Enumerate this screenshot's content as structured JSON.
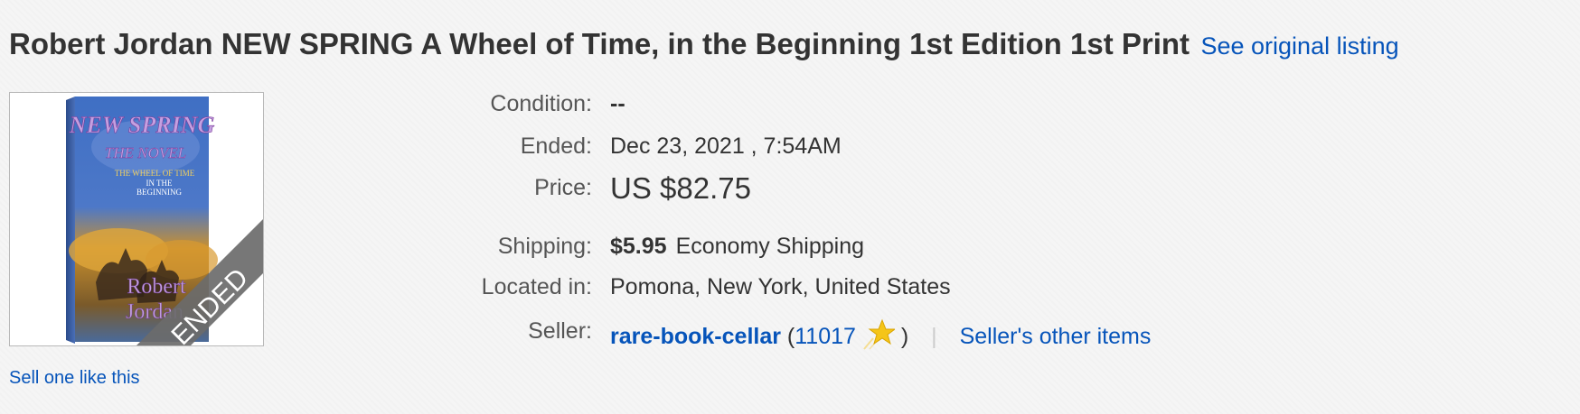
{
  "listing": {
    "title": "Robert Jordan NEW SPRING A Wheel of Time, in the Beginning 1st Edition 1st Print",
    "see_original": "See original listing",
    "sell_one": "Sell one like this",
    "image_badge": "ENDED",
    "cover": {
      "title_line1": "NEW SPRING",
      "title_line2": "THE NOVEL",
      "subtitle_line1": "THE WHEEL OF TIME",
      "subtitle_line2": "IN THE",
      "subtitle_line3": "BEGINNING",
      "author_line1": "Robert",
      "author_line2": "Jordan"
    }
  },
  "details": {
    "condition_label": "Condition:",
    "condition_value": "--",
    "ended_label": "Ended:",
    "ended_value": "Dec 23, 2021 , 7:54AM",
    "price_label": "Price:",
    "price_value": "US $82.75",
    "shipping_label": "Shipping:",
    "shipping_cost": "$5.95",
    "shipping_service": "Economy Shipping",
    "location_label": "Located in:",
    "location_value": "Pomona, New York, United States",
    "seller_label": "Seller:",
    "seller_name": "rare-book-cellar",
    "feedback_open": "(",
    "feedback_score": "11017",
    "feedback_close": ")",
    "separator": "|",
    "other_items": "Seller's other items",
    "star_icon": "shooting-star-icon"
  },
  "colors": {
    "link": "#0654ba",
    "badge": "#6b6b6b",
    "star": "#f5c518"
  }
}
